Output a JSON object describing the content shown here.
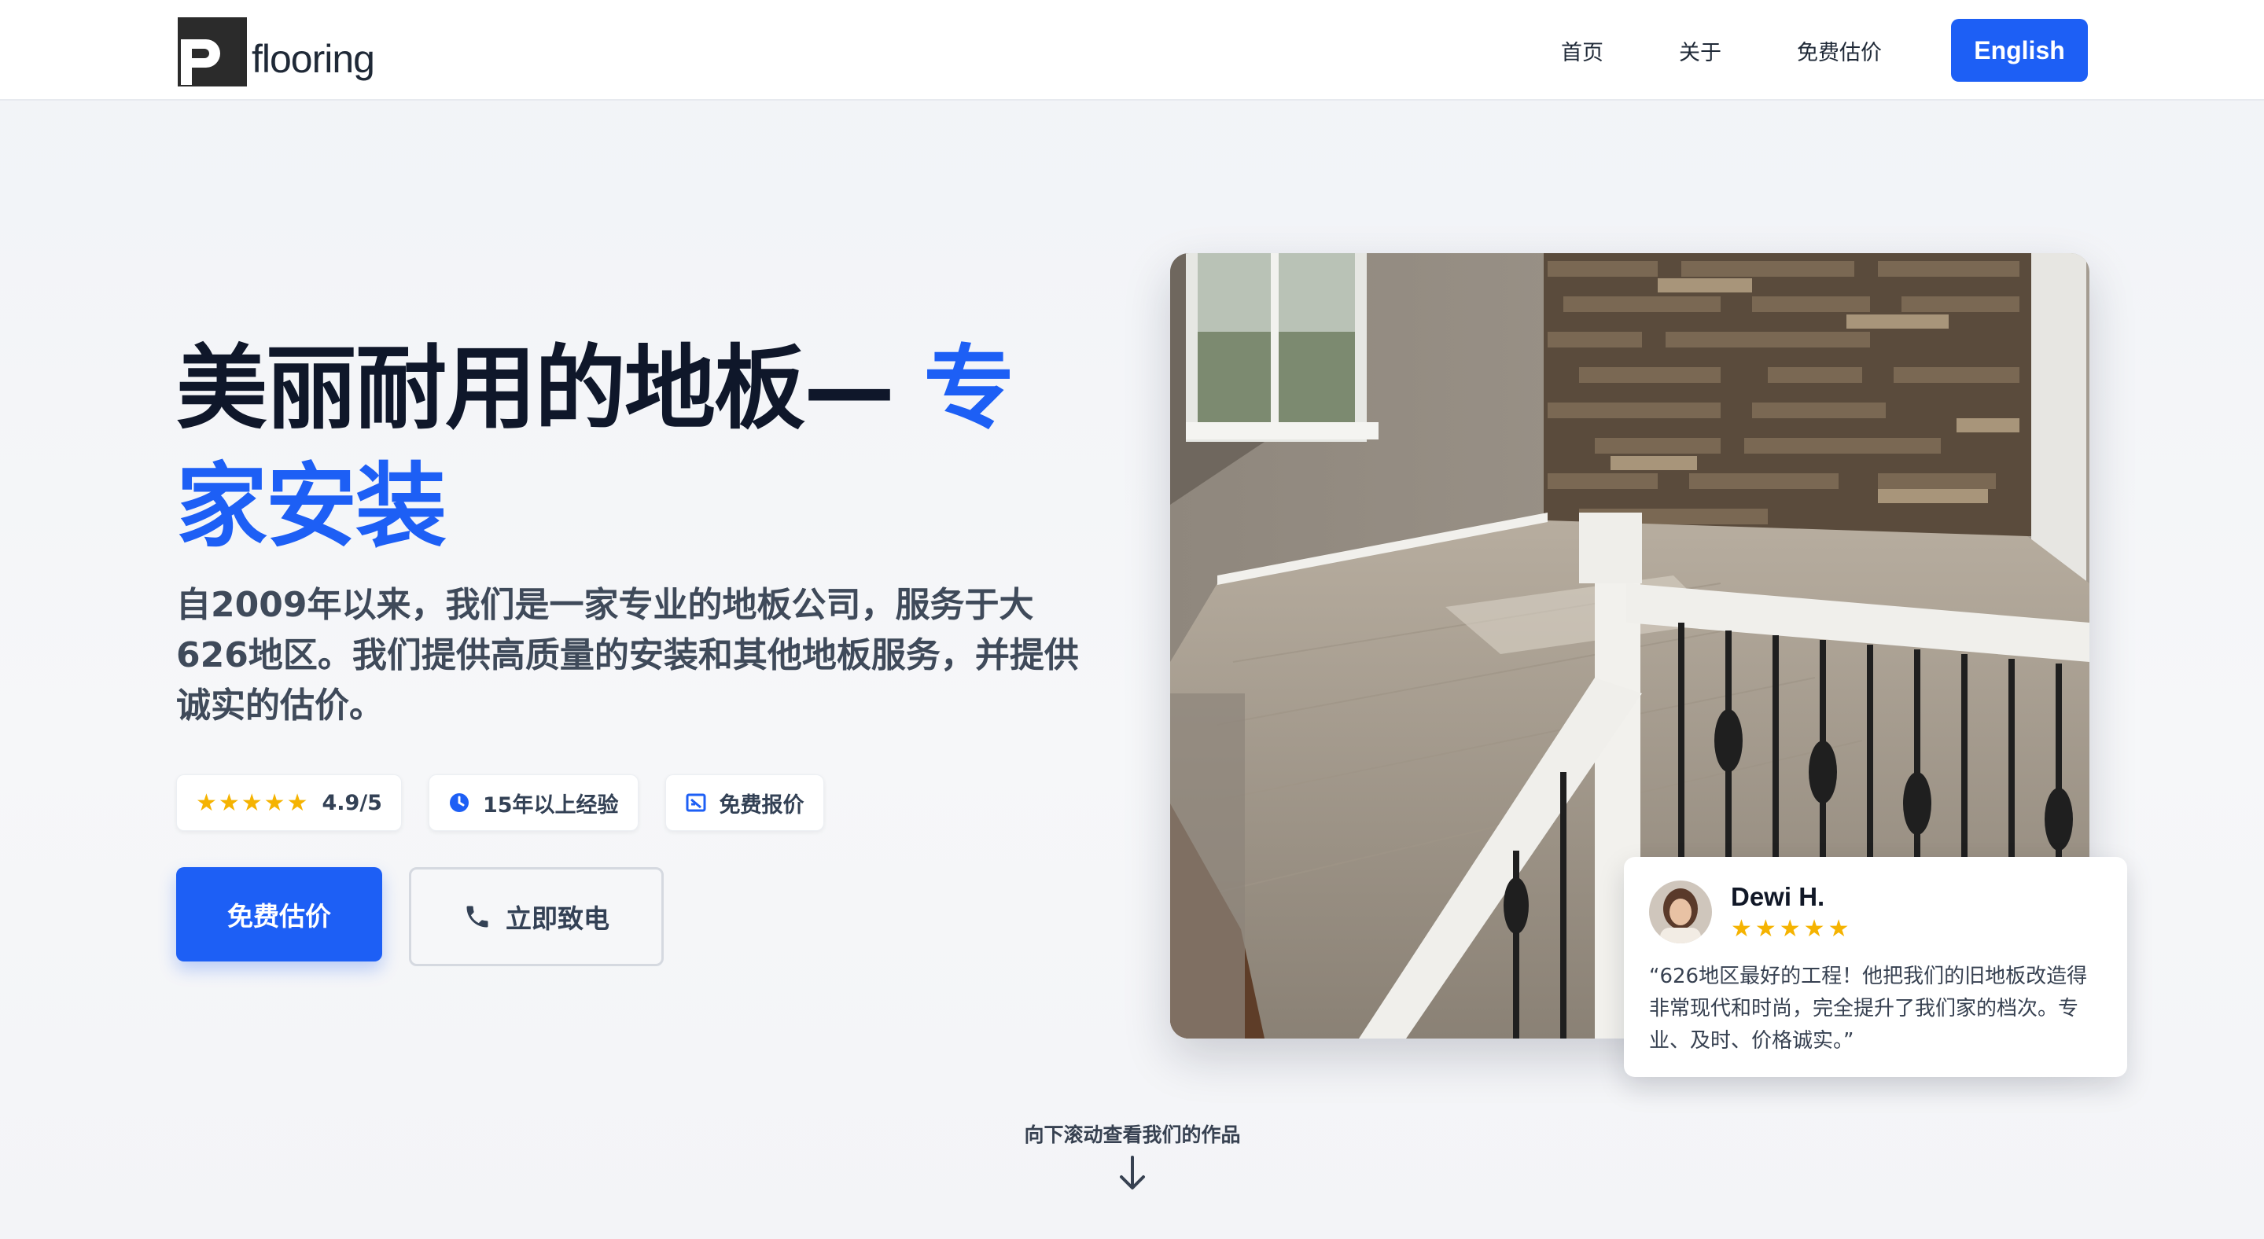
{
  "brand": {
    "name": "flooring"
  },
  "nav": {
    "links": [
      "首页",
      "关于",
      "免费估价"
    ],
    "language_button": "English"
  },
  "hero": {
    "title_main": "美丽耐用的地板— ",
    "title_accent": "专家安装",
    "description": "自2009年以来，我们是一家专业的地板公司，服务于大626地区。我们提供高质量的安装和其他地板服务，并提供诚实的估价。",
    "badges": {
      "rating_stars": "★★★★★",
      "rating": "4.9/5",
      "experience": "15年以上经验",
      "quote": "免费报价"
    },
    "primary_cta": "免费估价",
    "secondary_cta": "立即致电"
  },
  "review": {
    "name": "Dewi H.",
    "stars": "★★★★★",
    "text": "“626地区最好的工程！他把我们的旧地板改造得非常现代和时尚，完全提升了我们家的档次。专业、及时、价格诚实。”"
  },
  "scroll_hint": "向下滚动查看我们的作品",
  "colors": {
    "accent": "#1d5ff5",
    "star": "#f5b301",
    "text_dark": "#0f172a"
  }
}
